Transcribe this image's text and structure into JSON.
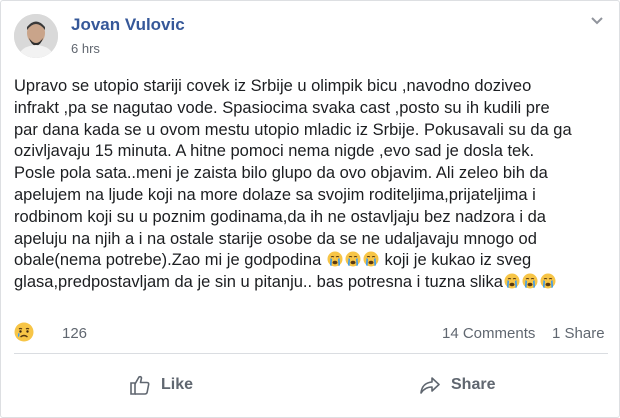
{
  "post": {
    "author": "Jovan Vulovic",
    "time": "6 hrs",
    "lines": [
      "Upravo se utopio stariji covek iz Srbije u olimpik bicu ,navodno doziveo",
      "infrakt ,pa se nagutao vode. Spasiocima svaka cast ,posto su ih kudili pre",
      "par dana kada se u ovom mestu utopio mladic iz Srbije. Pokusavali su da ga",
      "ozivljavaju 15 minuta. A hitne pomoci nema nigde ,evo sad je dosla tek.",
      "Posle pola sata..meni je zaista bilo glupo da ovo objavim. Ali zeleo bih da",
      "apelujem na ljude koji na more dolaze sa svojim roditeljima,prijateljima i",
      "rodbinom koji su u poznim godinama,da ih ne ostavljaju bez nadzora i da",
      "apeluju na njih a i na ostale starije osobe da se ne udaljavaju mnogo od"
    ],
    "line9_before": "obale(nema potrebe).Zao mi je godpodina ",
    "line9_after": " koji je kukao iz sveg",
    "line10": "glasa,predpostavljam da je sin u pitanju.. bas potresna i tuzna slika",
    "emoji_name": "crying-face-icon"
  },
  "stats": {
    "reaction_count": "126",
    "comments": "14 Comments",
    "shares": "1 Share"
  },
  "actions": {
    "like": "Like",
    "share": "Share"
  },
  "colors": {
    "author": "#365899",
    "meta": "#606770",
    "emoji_face": "#f7c547"
  }
}
